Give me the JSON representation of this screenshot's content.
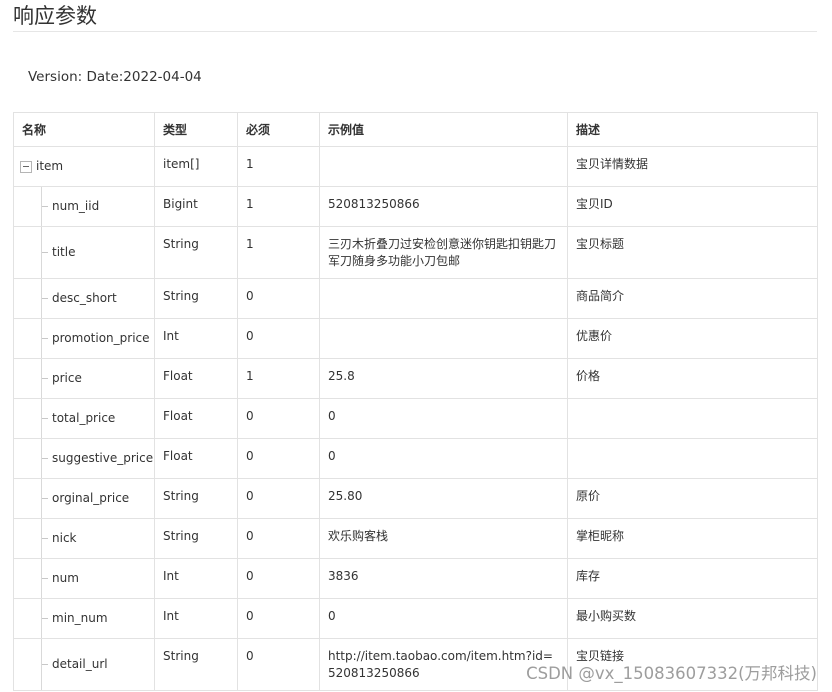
{
  "section": {
    "title": "响应参数",
    "version": "Version: Date:2022-04-04"
  },
  "table": {
    "headers": {
      "name": "名称",
      "type": "类型",
      "required": "必须",
      "example": "示例值",
      "description": "描述"
    },
    "root": {
      "name": "item",
      "type": "item[]",
      "required": "1",
      "example": "",
      "description": "宝贝详情数据"
    },
    "rows": [
      {
        "name": "num_iid",
        "type": "Bigint",
        "required": "1",
        "example": "520813250866",
        "description": "宝贝ID"
      },
      {
        "name": "title",
        "type": "String",
        "required": "1",
        "example": "三刃木折叠刀过安检创意迷你钥匙扣钥匙刀军刀随身多功能小刀包邮",
        "description": "宝贝标题"
      },
      {
        "name": "desc_short",
        "type": "String",
        "required": "0",
        "example": "",
        "description": "商品简介"
      },
      {
        "name": "promotion_price",
        "type": "Int",
        "required": "0",
        "example": "",
        "description": "优惠价"
      },
      {
        "name": "price",
        "type": "Float",
        "required": "1",
        "example": "25.8",
        "description": "价格"
      },
      {
        "name": "total_price",
        "type": "Float",
        "required": "0",
        "example": "0",
        "description": ""
      },
      {
        "name": "suggestive_price",
        "type": "Float",
        "required": "0",
        "example": "0",
        "description": ""
      },
      {
        "name": "orginal_price",
        "type": "String",
        "required": "0",
        "example": "25.80",
        "description": "原价"
      },
      {
        "name": "nick",
        "type": "String",
        "required": "0",
        "example": "欢乐购客栈",
        "description": "掌柜昵称"
      },
      {
        "name": "num",
        "type": "Int",
        "required": "0",
        "example": "3836",
        "description": "库存"
      },
      {
        "name": "min_num",
        "type": "Int",
        "required": "0",
        "example": "0",
        "description": "最小购买数"
      },
      {
        "name": "detail_url",
        "type": "String",
        "required": "0",
        "example": "http://item.taobao.com/item.htm?id=520813250866",
        "description": "宝贝链接"
      }
    ]
  },
  "watermark": "CSDN @vx_15083607332(万邦科技)",
  "icons": {
    "collapse": "collapse-minus-icon"
  },
  "colors": {
    "border": "#e2e2e2",
    "text": "#333333",
    "watermark": "#8c8c8c"
  }
}
